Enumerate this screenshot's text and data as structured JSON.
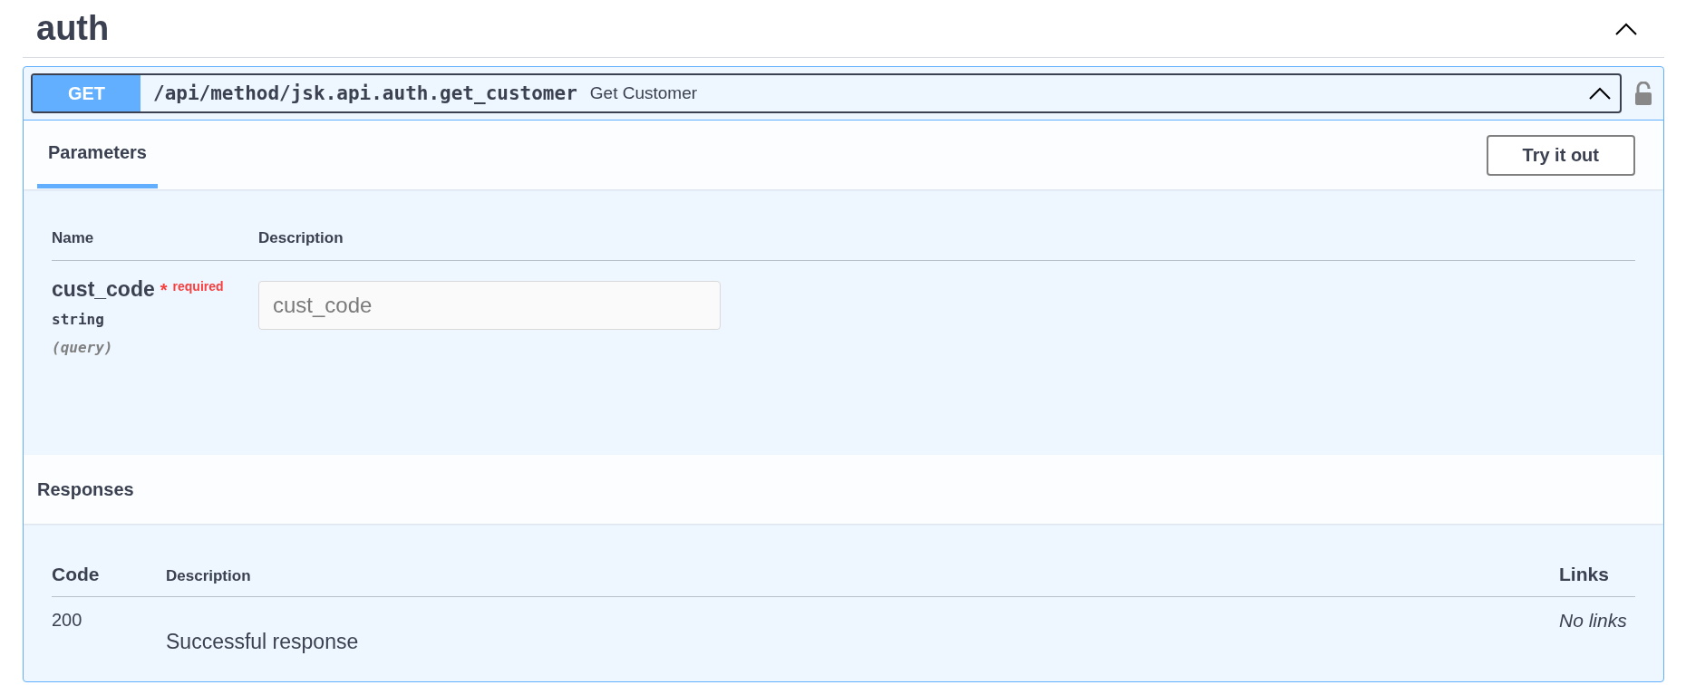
{
  "tag": {
    "name": "auth",
    "expanded": true
  },
  "operation": {
    "method": "GET",
    "path": "/api/method/jsk.api.auth.get_customer",
    "summary": "Get Customer",
    "expanded": true,
    "locked": false
  },
  "tabs": [
    {
      "label": "Parameters",
      "selected": true
    }
  ],
  "try_button": "Try it out",
  "parameters": {
    "columns": [
      "Name",
      "Description"
    ],
    "rows": [
      {
        "name": "cust_code",
        "required_mark": "*",
        "required_label": "required",
        "type": "string",
        "location": "(query)",
        "placeholder": "cust_code"
      }
    ]
  },
  "responses": {
    "title": "Responses",
    "columns": [
      "Code",
      "Description",
      "Links"
    ],
    "rows": [
      {
        "code": "200",
        "description": "Successful response",
        "links": "No links"
      }
    ]
  }
}
